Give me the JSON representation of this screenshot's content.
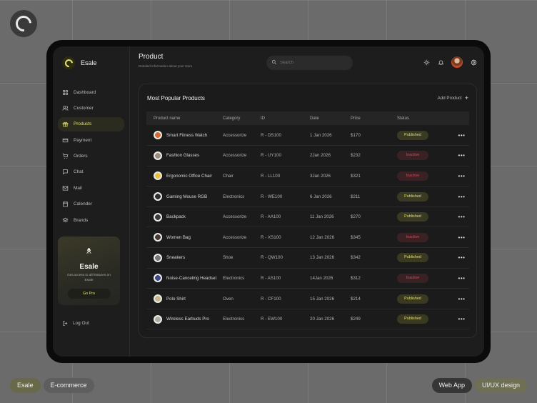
{
  "brand": {
    "name": "Esale"
  },
  "sidebar": {
    "items": [
      {
        "label": "Dashboard",
        "icon": "grid-icon"
      },
      {
        "label": "Customer",
        "icon": "users-icon"
      },
      {
        "label": "Products",
        "icon": "gift-icon",
        "active": true
      },
      {
        "label": "Payment",
        "icon": "card-icon"
      },
      {
        "label": "Orders",
        "icon": "cart-icon"
      },
      {
        "label": "Chat",
        "icon": "chat-icon"
      },
      {
        "label": "Mail",
        "icon": "mail-icon"
      },
      {
        "label": "Calender",
        "icon": "calendar-icon"
      },
      {
        "label": "Brands",
        "icon": "layers-icon"
      }
    ],
    "promo": {
      "title": "Esale",
      "text": "Get access to all features on Esale",
      "button": "Go Pro"
    },
    "logout": "Log Out"
  },
  "header": {
    "title": "Product",
    "subtitle": "Detailed information about your store",
    "search_placeholder": "Search"
  },
  "card": {
    "title": "Most Popular Products",
    "add_label": "Add Product",
    "columns": [
      "Product name",
      "Category",
      "ID",
      "Date",
      "Price",
      "Status"
    ],
    "rows": [
      {
        "name": "Smart Fitness Watch",
        "category": "Accessorize",
        "id": "R - DS100",
        "date": "1 Jan 2026",
        "price": "$170",
        "status": "Published",
        "color": "#d9682e"
      },
      {
        "name": "Fashion Glasses",
        "category": "Accessorize",
        "id": "R - UY100",
        "date": "2Jan 2026",
        "price": "$232",
        "status": "Inactive",
        "color": "#9a8e7a"
      },
      {
        "name": "Ergonomic Office Chair",
        "category": "Chair",
        "id": "R - LL100",
        "date": "3Jan 2026",
        "price": "$321",
        "status": "Inactive",
        "color": "#e6c23a"
      },
      {
        "name": "Gaming Mouse RGB",
        "category": "Electronics",
        "id": "R - WE100",
        "date": "6 Jan 2026",
        "price": "$211",
        "status": "Published",
        "color": "#2d2d2d"
      },
      {
        "name": "Backpack",
        "category": "Accessorize",
        "id": "R - AA100",
        "date": "11 Jan 2026",
        "price": "$270",
        "status": "Published",
        "color": "#3c3c3c"
      },
      {
        "name": "Women Bag",
        "category": "Accessorize",
        "id": "R - XS100",
        "date": "12 Jan 2026",
        "price": "$345",
        "status": "Inactive",
        "color": "#4a3a30"
      },
      {
        "name": "Sneakers",
        "category": "Shoe",
        "id": "R - QW100",
        "date": "13 Jan 2026",
        "price": "$342",
        "status": "Published",
        "color": "#777777"
      },
      {
        "name": "Noise-Canceling Headset",
        "category": "Electronics",
        "id": "R - AS100",
        "date": "14Jan 2026",
        "price": "$312",
        "status": "Inactive",
        "color": "#3a4a8a"
      },
      {
        "name": "Polo Shirt",
        "category": "Oven",
        "id": "R - CF100",
        "date": "15 Jan 2026",
        "price": "$214",
        "status": "Published",
        "color": "#c8b48a"
      },
      {
        "name": "Wireless Earbuds Pro",
        "category": "Electronics",
        "id": "R - EW100",
        "date": "20 Jan 2026",
        "price": "$249",
        "status": "Published",
        "color": "#b0aaa0"
      }
    ]
  },
  "tags": {
    "left": [
      "Esale",
      "E-commerce"
    ],
    "right": [
      "Web App",
      "UI/UX design"
    ]
  },
  "colors": {
    "accent": "#e4e36d",
    "published": "#e5df6c",
    "inactive": "#d9495c"
  }
}
